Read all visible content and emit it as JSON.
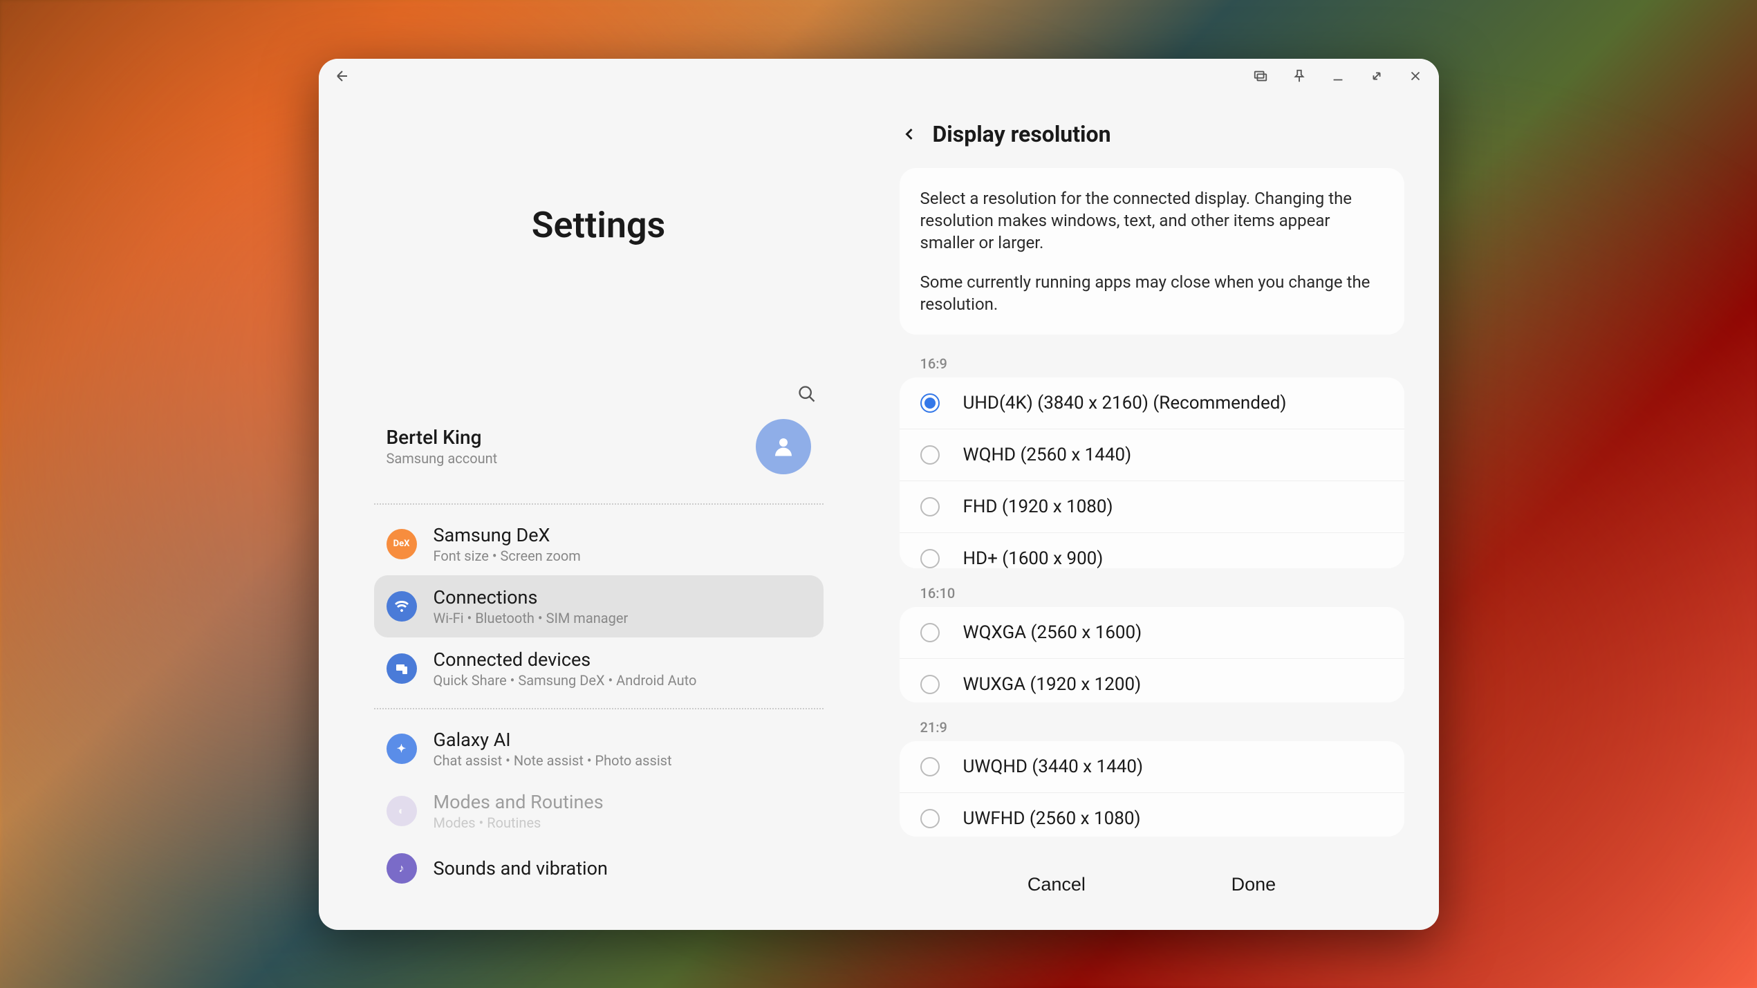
{
  "page_title": "Settings",
  "account": {
    "name": "Bertel King",
    "sub": "Samsung account"
  },
  "sidebar": {
    "items": [
      {
        "title": "Samsung DeX",
        "sub": "Font size  •  Screen zoom"
      },
      {
        "title": "Connections",
        "sub": "Wi-Fi  •  Bluetooth  •  SIM manager"
      },
      {
        "title": "Connected devices",
        "sub": "Quick Share  •  Samsung DeX  •  Android Auto"
      },
      {
        "title": "Galaxy AI",
        "sub": "Chat assist  •  Note assist  •  Photo assist"
      },
      {
        "title": "Modes and Routines",
        "sub": "Modes  •  Routines"
      },
      {
        "title": "Sounds and vibration",
        "sub": ""
      }
    ]
  },
  "detail": {
    "title": "Display resolution",
    "info_p1": "Select a resolution for the connected display. Changing the resolution makes windows, text, and other items appear smaller or larger.",
    "info_p2": "Some currently running apps may close when you change the resolution.",
    "groups": [
      {
        "label": "16:9",
        "options": [
          {
            "label": "UHD(4K) (3840 x 2160) (Recommended)",
            "checked": true
          },
          {
            "label": "WQHD (2560 x 1440)",
            "checked": false
          },
          {
            "label": "FHD (1920 x 1080)",
            "checked": false
          },
          {
            "label": "HD+ (1600 x 900)",
            "checked": false
          }
        ]
      },
      {
        "label": "16:10",
        "options": [
          {
            "label": "WQXGA (2560 x 1600)",
            "checked": false
          },
          {
            "label": "WUXGA (1920 x 1200)",
            "checked": false
          }
        ]
      },
      {
        "label": "21:9",
        "options": [
          {
            "label": "UWQHD (3440 x 1440)",
            "checked": false
          },
          {
            "label": "UWFHD (2560 x 1080)",
            "checked": false
          }
        ]
      }
    ],
    "cancel_label": "Cancel",
    "done_label": "Done"
  }
}
